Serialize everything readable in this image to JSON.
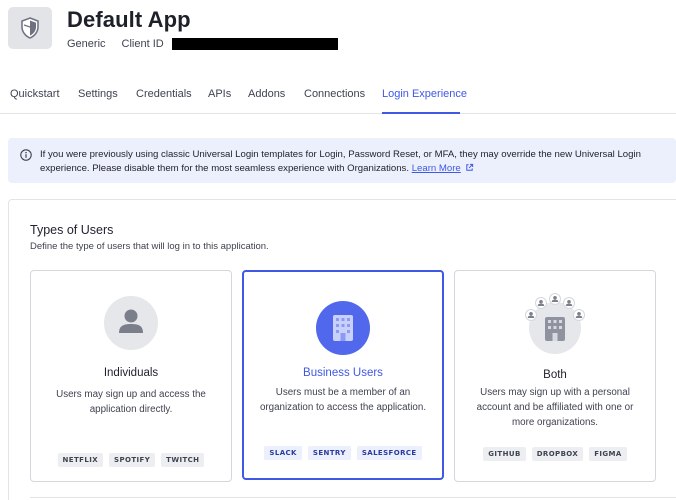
{
  "app": {
    "title": "Default App",
    "type": "Generic",
    "client_id_label": "Client ID",
    "logo_icon": "shield-icon"
  },
  "tabs": [
    {
      "label": "Quickstart",
      "active": false
    },
    {
      "label": "Settings",
      "active": false
    },
    {
      "label": "Credentials",
      "active": false
    },
    {
      "label": "APIs",
      "active": false
    },
    {
      "label": "Addons",
      "active": false
    },
    {
      "label": "Connections",
      "active": false
    },
    {
      "label": "Login Experience",
      "active": true
    }
  ],
  "banner": {
    "icon": "info-icon",
    "text": "If you were previously using classic Universal Login templates for Login, Password Reset, or MFA, they may override the new Universal Login experience. Please disable them for the most seamless experience with Organizations.",
    "link_label": "Learn More",
    "link_icon": "external-link-icon"
  },
  "section": {
    "title": "Types of Users",
    "description": "Define the type of users that will log in to this application."
  },
  "cards": [
    {
      "title": "Individuals",
      "description": "Users may sign up and access the application directly.",
      "badges": [
        "NETFLIX",
        "SPOTIFY",
        "TWITCH"
      ],
      "selected": false,
      "icon": "user-icon"
    },
    {
      "title": "Business Users",
      "description": "Users must be a member of an organization to access the application.",
      "badges": [
        "SLACK",
        "SENTRY",
        "SALESFORCE"
      ],
      "selected": true,
      "icon": "building-icon"
    },
    {
      "title": "Both",
      "description": "Users may sign up with a personal account and be affiliated with one or more organizations.",
      "badges": [
        "GITHUB",
        "DROPBOX",
        "FIGMA"
      ],
      "selected": false,
      "icon": "building-with-users-icon"
    }
  ],
  "colors": {
    "accent": "#3f59e4",
    "banner_bg": "#eceffc",
    "text": "#1e212a",
    "muted": "#3f4350"
  }
}
